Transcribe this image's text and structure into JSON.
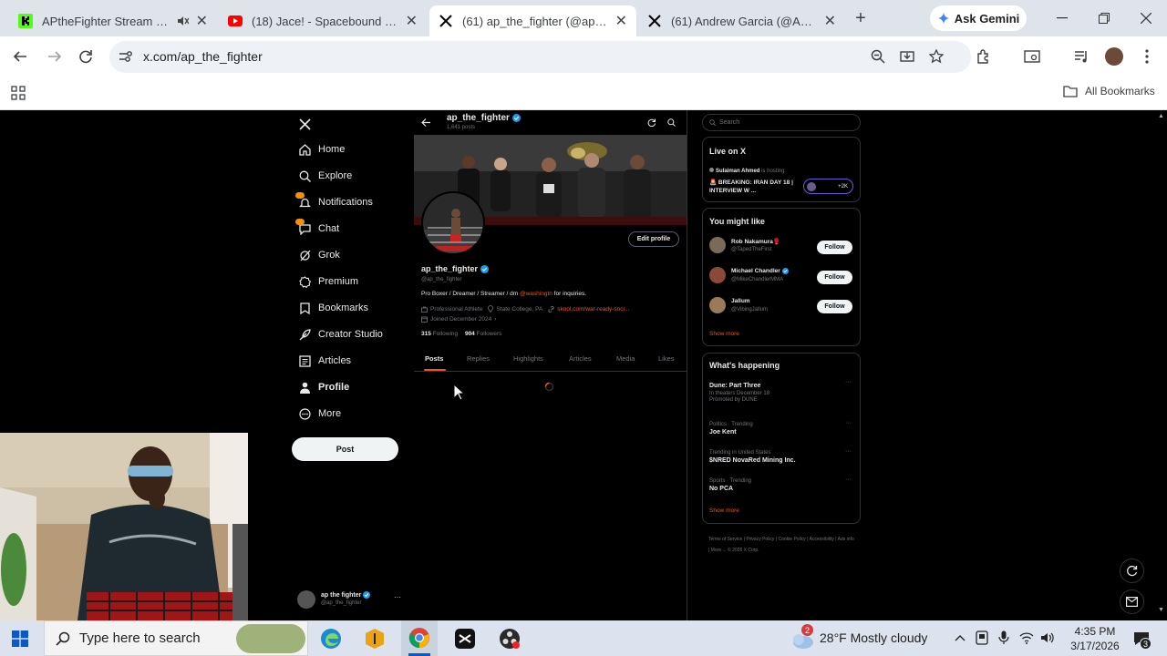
{
  "browser": {
    "tabs": [
      {
        "title": "APtheFighter Stream - Wa",
        "icon": "kick-icon"
      },
      {
        "title": "(18) Jace! - Spacebound (Offic",
        "icon": "youtube-icon"
      },
      {
        "title": "(61) ap_the_fighter (@ap_the_",
        "icon": "x-icon"
      },
      {
        "title": "(61) Andrew Garcia (@Andrew",
        "icon": "x-icon"
      }
    ],
    "ask_gemini": "Ask Gemini",
    "url": "x.com/ap_the_fighter",
    "all_bookmarks": "All Bookmarks"
  },
  "sidebar": {
    "items": [
      {
        "label": "Home",
        "icon": "home-icon"
      },
      {
        "label": "Explore",
        "icon": "search-icon"
      },
      {
        "label": "Notifications",
        "icon": "bell-icon"
      },
      {
        "label": "Chat",
        "icon": "chat-icon"
      },
      {
        "label": "Grok",
        "icon": "grok-icon"
      },
      {
        "label": "Premium",
        "icon": "x-premium-icon"
      },
      {
        "label": "Bookmarks",
        "icon": "bookmark-icon"
      },
      {
        "label": "Creator Studio",
        "icon": "feather-icon"
      },
      {
        "label": "Articles",
        "icon": "article-icon"
      },
      {
        "label": "Profile",
        "icon": "person-icon"
      },
      {
        "label": "More",
        "icon": "more-icon"
      }
    ],
    "post_button": "Post",
    "account": {
      "name": "ap the fighter",
      "handle": "@ap_the_fighter"
    }
  },
  "profile": {
    "header_name": "ap_the_fighter",
    "header_posts": "1,641 posts",
    "name": "ap_the_fighter",
    "handle": "@ap_the_fighter",
    "edit_profile": "Edit profile",
    "bio_prefix": "Pro Boxer / Dreamer / Streamer / dm ",
    "bio_mention": "@washingtn",
    "bio_suffix": " for inquiries.",
    "category": "Professional Athlete",
    "location": "State College, PA",
    "link": "skool.com/war-ready-soci...",
    "joined": "Joined December 2024",
    "following_count": "315",
    "following_label": "Following",
    "followers_count": "904",
    "followers_label": "Followers",
    "tabs": [
      "Posts",
      "Replies",
      "Highlights",
      "Articles",
      "Media",
      "Likes"
    ]
  },
  "right": {
    "search_placeholder": "Search",
    "live": {
      "title": "Live on X",
      "host": "Sulaiman Ahmed",
      "host_suffix": " is hosting",
      "headline": "🚨 BREAKING: IRAN DAY 18 | INTERVIEW W ...",
      "listeners": "+2K"
    },
    "might_like": {
      "title": "You might like",
      "people": [
        {
          "name": "Rob Nakamura🥊",
          "handle": "@TapedTheFirst"
        },
        {
          "name": "Michael Chandler",
          "handle": "@MikeChandlerMMA"
        },
        {
          "name": "Jallum",
          "handle": "@VibingJallum"
        }
      ],
      "follow": "Follow",
      "show_more": "Show more"
    },
    "happening": {
      "title": "What's happening",
      "items": [
        {
          "category": "",
          "title": "Dune: Part Three",
          "extra": "In theaters December 18",
          "extra2": "Promoted by DUNE"
        },
        {
          "category": "Politics · Trending",
          "title": "Joe Kent",
          "extra": "",
          "extra2": ""
        },
        {
          "category": "Trending in United States",
          "title": "$NRED NovaRed Mining Inc.",
          "extra": "",
          "extra2": ""
        },
        {
          "category": "Sports · Trending",
          "title": "No PCA",
          "extra": "",
          "extra2": ""
        }
      ],
      "show_more": "Show more"
    },
    "footer": [
      "Terms of Service",
      "Privacy Policy",
      "Cookie Policy",
      "Accessibility",
      "Ads info",
      "More ...",
      "© 2026 X Corp."
    ]
  },
  "taskbar": {
    "search_placeholder": "Type here to search",
    "weather": "28°F  Mostly cloudy",
    "time": "4:35 PM",
    "date": "3/17/2026",
    "notif_badge": "2",
    "notif_count": "3"
  },
  "colors": {
    "accent": "#1d9bf0",
    "bg": "#000000",
    "border": "#2f3336",
    "taskbar": "#dce3ee",
    "tabstrip": "#dfe3ea"
  }
}
